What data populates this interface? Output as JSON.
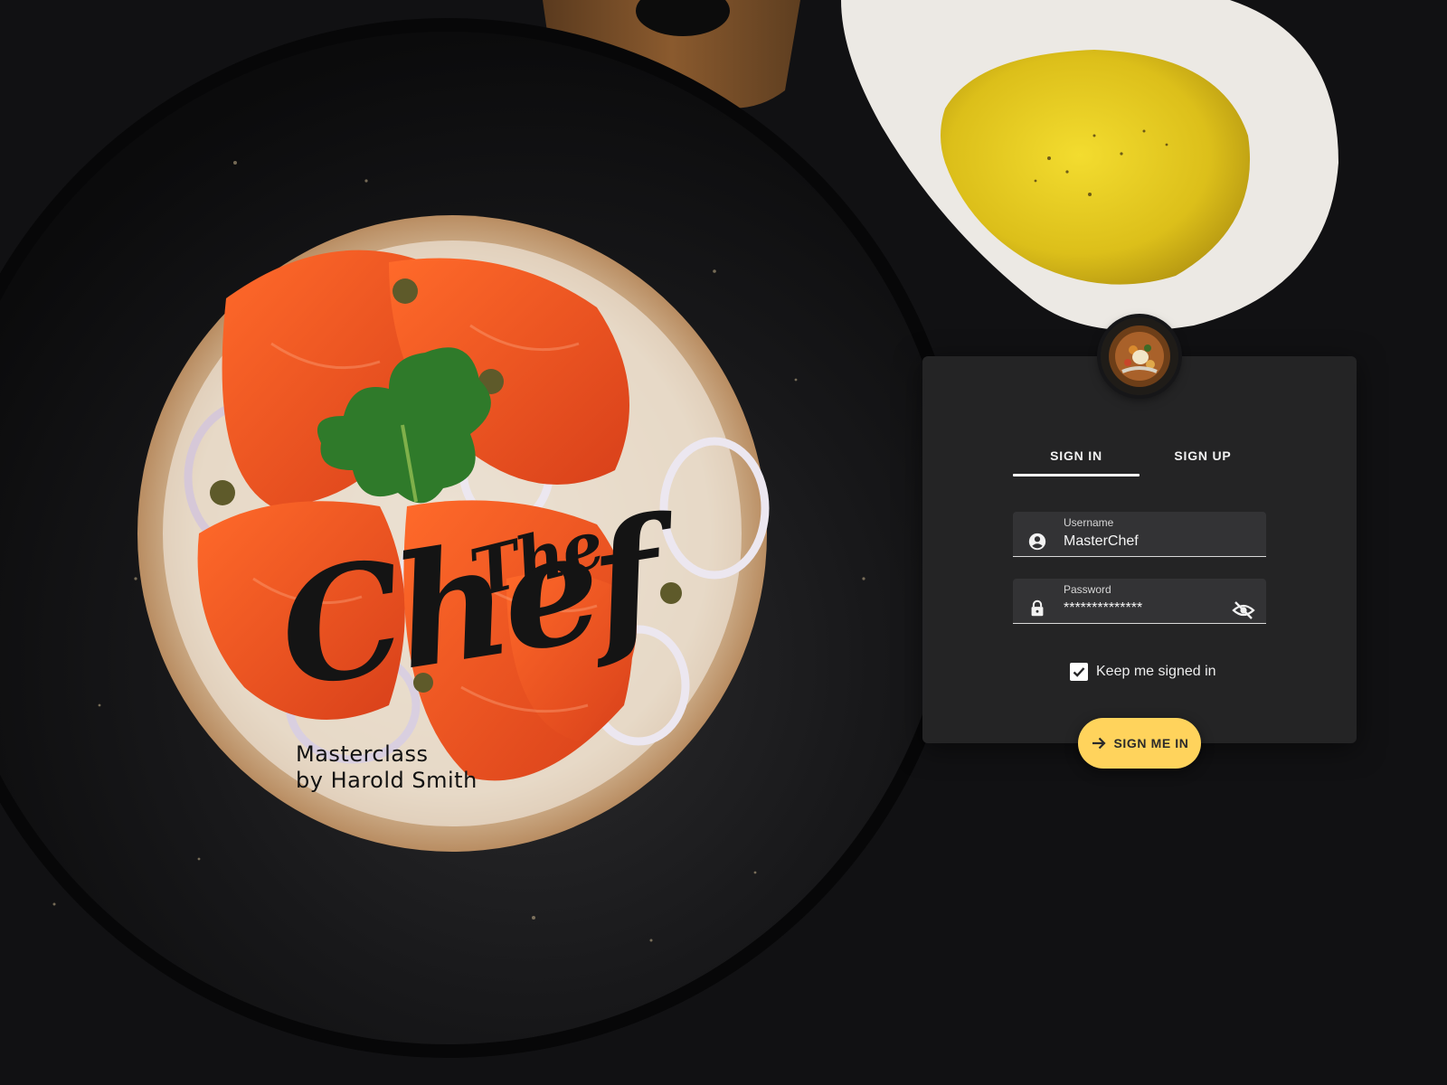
{
  "brand": {
    "title_small": "The",
    "title_large": "Chef",
    "subtitle_line1": "Masterclass",
    "subtitle_line2": "by Harold Smith"
  },
  "tabs": [
    {
      "label": "SIGN IN",
      "active": true
    },
    {
      "label": "SIGN UP",
      "active": false
    }
  ],
  "form": {
    "username": {
      "label": "Username",
      "value": "MasterChef",
      "icon": "account-circle-icon"
    },
    "password": {
      "label": "Password",
      "value": "**************",
      "icon": "lock-icon",
      "toggle_icon": "visibility-off-icon"
    },
    "keep_signed_in": {
      "label": "Keep me signed in",
      "checked": true
    },
    "submit": {
      "label": "SIGN ME IN",
      "icon": "arrow-forward-icon"
    }
  },
  "colors": {
    "accent": "#ffd35c",
    "panel": "#252527",
    "field": "#333335",
    "background": "#111113"
  }
}
